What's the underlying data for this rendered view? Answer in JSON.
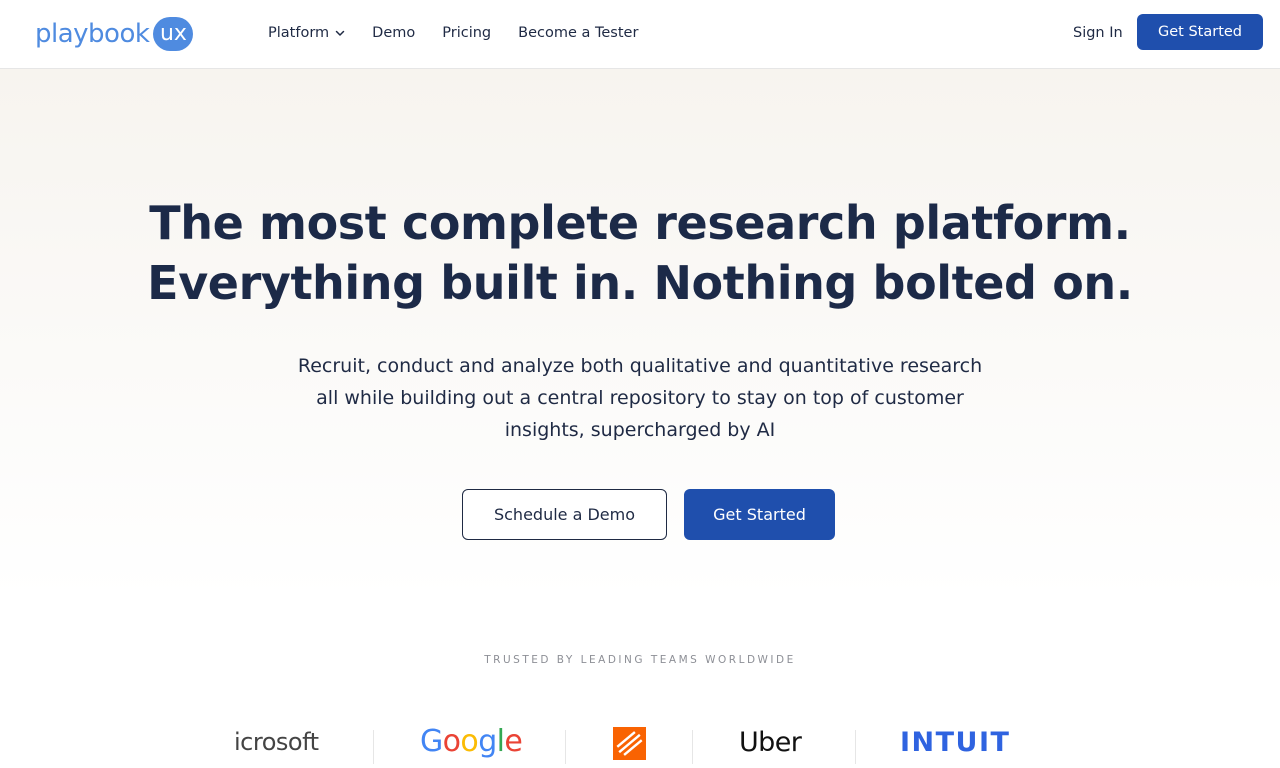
{
  "header": {
    "logo_text": "playbook",
    "logo_badge": "ux",
    "nav": [
      {
        "label": "Platform",
        "has_dropdown": true
      },
      {
        "label": "Demo"
      },
      {
        "label": "Pricing"
      },
      {
        "label": "Become a Tester"
      }
    ],
    "signin_label": "Sign In",
    "get_started_label": "Get Started"
  },
  "hero": {
    "headline_line1": "The most complete research platform.",
    "headline_line2": "Everything built in. Nothing bolted on.",
    "subhead_line1": "Recruit, conduct and analyze both qualitative and quantitative research",
    "subhead_line2": "all while building out a central repository to stay on top of customer",
    "subhead_line3": "insights, supercharged by AI",
    "demo_button": "Schedule a Demo",
    "get_started_button": "Get Started"
  },
  "trusted": {
    "label": "TRUSTED BY LEADING TEAMS WORLDWIDE",
    "logos": {
      "microsoft": "icrosoft",
      "google": [
        "G",
        "o",
        "o",
        "g",
        "l",
        "e"
      ],
      "uber": "Uber",
      "intuit": "INTUIT"
    },
    "google_colors": [
      "#4285F4",
      "#EA4335",
      "#FBBC05",
      "#4285F4",
      "#34A853",
      "#EA4335"
    ]
  },
  "colors": {
    "primary": "#1f4fad",
    "logo_blue": "#4f8be0",
    "text": "#1f2a44",
    "home_depot": "#f96302",
    "intuit": "#2f63e0"
  }
}
